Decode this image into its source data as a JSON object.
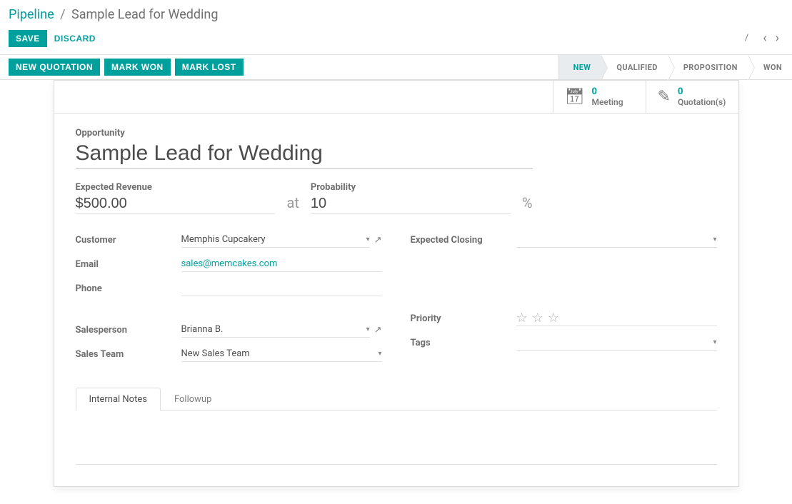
{
  "breadcrumb": {
    "root": "Pipeline",
    "sep": "/",
    "current": "Sample Lead for Wedding"
  },
  "control": {
    "save": "SAVE",
    "discard": "DISCARD",
    "pager_sep": "/"
  },
  "statusbar": {
    "new_quotation": "NEW QUOTATION",
    "mark_won": "MARK WON",
    "mark_lost": "MARK LOST",
    "stages": [
      "NEW",
      "QUALIFIED",
      "PROPOSITION",
      "WON"
    ],
    "active_stage": "NEW"
  },
  "stats": {
    "meeting": {
      "count": "0",
      "label": "Meeting"
    },
    "quotations": {
      "count": "0",
      "label": "Quotation(s)"
    }
  },
  "form": {
    "opportunity_label": "Opportunity",
    "opportunity_value": "Sample Lead for Wedding",
    "expected_revenue_label": "Expected Revenue",
    "expected_revenue_value": "$500.00",
    "at_text": "at",
    "probability_label": "Probability",
    "probability_value": "10",
    "pct_text": "%",
    "customer_label": "Customer",
    "customer_value": "Memphis Cupcakery",
    "email_label": "Email",
    "email_value": "sales@memcakes.com",
    "phone_label": "Phone",
    "phone_value": "",
    "salesperson_label": "Salesperson",
    "salesperson_value": "Brianna B.",
    "salesteam_label": "Sales Team",
    "salesteam_value": "New Sales Team",
    "expected_closing_label": "Expected Closing",
    "expected_closing_value": "",
    "priority_label": "Priority",
    "tags_label": "Tags",
    "tags_value": ""
  },
  "tabs": {
    "internal_notes": "Internal Notes",
    "followup": "Followup"
  }
}
